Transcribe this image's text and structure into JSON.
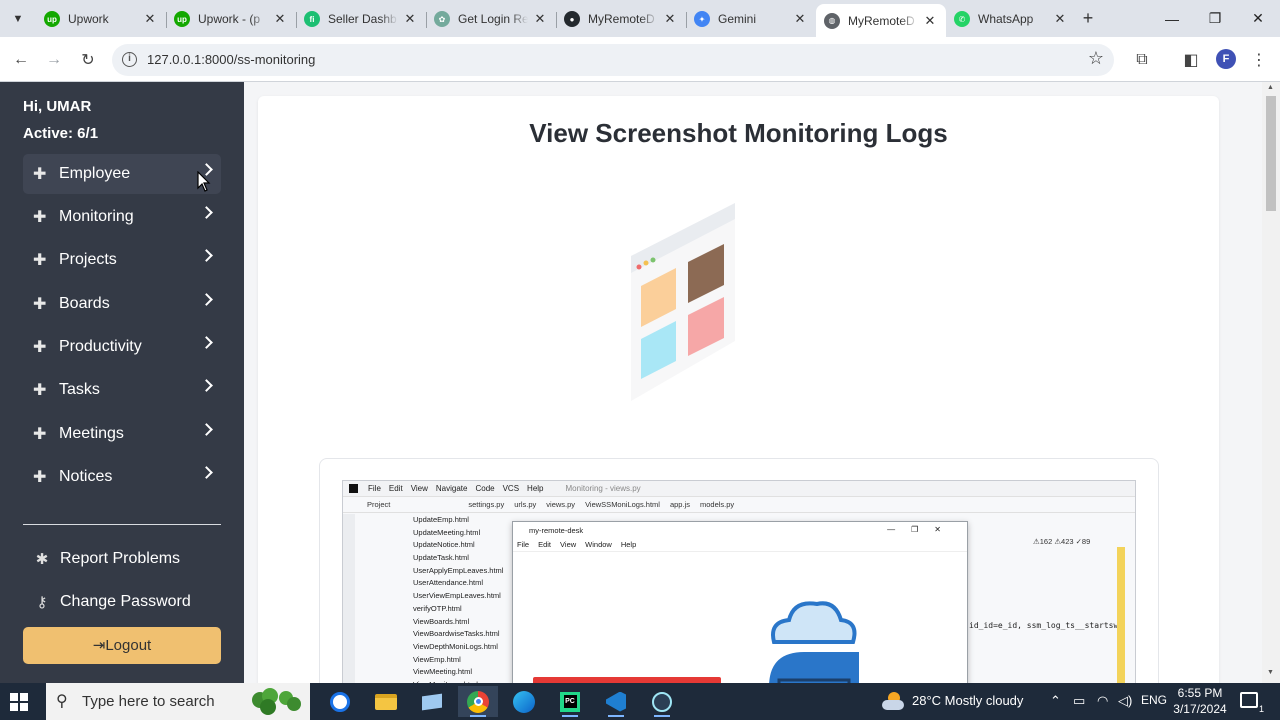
{
  "browser": {
    "tabs": [
      {
        "title": "Upwork",
        "icon": "upwork-icon",
        "color": "#14a800",
        "glyph": "up",
        "active": false
      },
      {
        "title": "Upwork - (p",
        "icon": "upwork-icon",
        "color": "#14a800",
        "glyph": "up",
        "active": false
      },
      {
        "title": "Seller Dashb",
        "icon": "fiverr-icon",
        "color": "#1dbf73",
        "glyph": "fi",
        "active": false
      },
      {
        "title": "Get Login Re",
        "icon": "chatgpt-icon",
        "color": "#74aa9c",
        "glyph": "✿",
        "active": false
      },
      {
        "title": "MyRemoteD",
        "icon": "github-icon",
        "color": "#24292e",
        "glyph": "●",
        "active": false
      },
      {
        "title": "Gemini",
        "icon": "gemini-icon",
        "color": "#4285f4",
        "glyph": "✦",
        "active": false
      },
      {
        "title": "MyRemoteD",
        "icon": "globe-icon",
        "color": "#5f6368",
        "glyph": "◍",
        "active": true
      },
      {
        "title": "WhatsApp",
        "icon": "whatsapp-icon",
        "color": "#25d366",
        "glyph": "✆",
        "active": false
      }
    ],
    "url": "127.0.0.1:8000/ss-monitoring",
    "profile_initial": "F"
  },
  "sidebar": {
    "greeting": "Hi, UMAR",
    "active": "Active: 6/1",
    "items": [
      {
        "label": "Employee"
      },
      {
        "label": "Monitoring"
      },
      {
        "label": "Projects"
      },
      {
        "label": "Boards"
      },
      {
        "label": "Productivity"
      },
      {
        "label": "Tasks"
      },
      {
        "label": "Meetings"
      },
      {
        "label": "Notices"
      }
    ],
    "report_label": "Report Problems",
    "password_label": "Change Password",
    "logout_label": "Logout"
  },
  "main": {
    "title": "View Screenshot Monitoring Logs"
  },
  "screenshot": {
    "ide_menu": [
      "File",
      "Edit",
      "View",
      "Navigate",
      "Code",
      "VCS",
      "Help"
    ],
    "ide_title": "Monitoring - views.py",
    "ide_project_label": "Project",
    "ide_tabs": [
      "settings.py",
      "urls.py",
      "views.py",
      "ViewSSMoniLogs.html",
      "app.js",
      "models.py"
    ],
    "files": [
      "UpdateEmp.html",
      "UpdateMeeting.html",
      "UpdateNotice.html",
      "UpdateTask.html",
      "UserApplyEmpLeaves.html",
      "UserAttendance.html",
      "UserViewEmpLeaves.html",
      "verifyOTP.html",
      "ViewBoards.html",
      "ViewBoardwiseTasks.html",
      "ViewDepthMoniLogs.html",
      "ViewEmp.html",
      "ViewMeeting.html",
      "ViewMoniLogs.html"
    ],
    "code_line": "id_id=e_id, ssm_log_ts__startswi",
    "warnings": "⚠162  ⚠423  ✓89",
    "app_title": "my-remote-desk",
    "app_menu": [
      "File",
      "Edit",
      "View",
      "Window",
      "Help"
    ]
  },
  "taskbar": {
    "search_placeholder": "Type here to search",
    "weather": "28°C  Mostly cloudy",
    "language": "ENG",
    "time": "6:55 PM",
    "date": "3/17/2024",
    "notifications": "1"
  }
}
